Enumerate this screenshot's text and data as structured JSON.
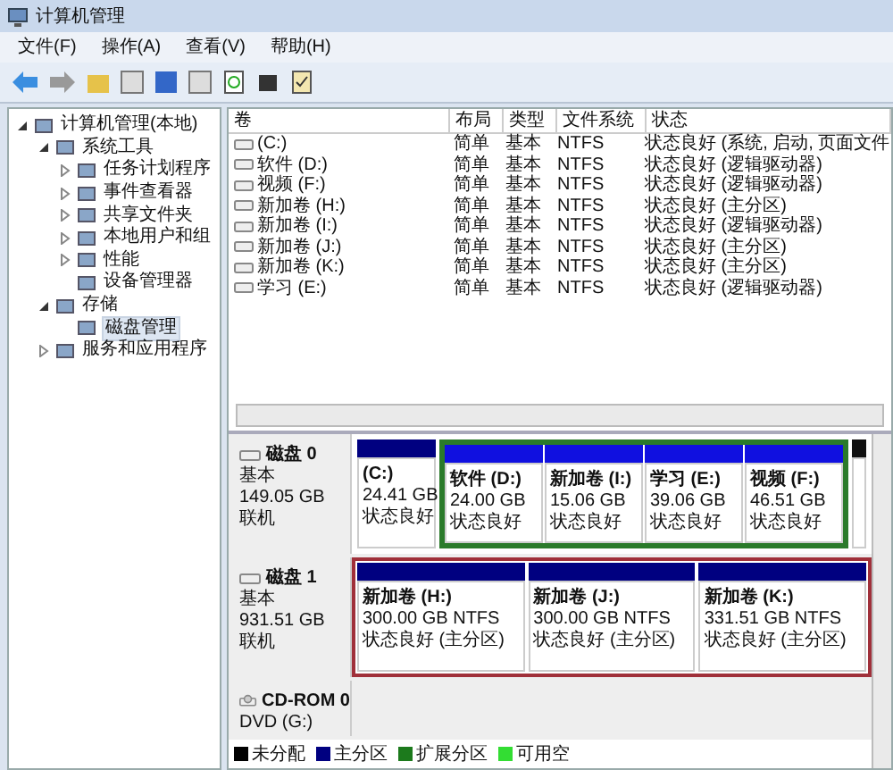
{
  "window": {
    "title": "计算机管理"
  },
  "menu": [
    "文件(F)",
    "操作(A)",
    "查看(V)",
    "帮助(H)"
  ],
  "tree": [
    {
      "label": "计算机管理(本地)",
      "expanded": true,
      "selected": false,
      "children": [
        {
          "label": "系统工具",
          "expanded": true,
          "selected": false,
          "children": [
            {
              "label": "任务计划程序",
              "expanded": false,
              "selected": false
            },
            {
              "label": "事件查看器",
              "expanded": false,
              "selected": false
            },
            {
              "label": "共享文件夹",
              "expanded": false,
              "selected": false
            },
            {
              "label": "本地用户和组",
              "expanded": false,
              "selected": false
            },
            {
              "label": "性能",
              "expanded": false,
              "selected": false
            },
            {
              "label": "设备管理器",
              "selected": false
            }
          ]
        },
        {
          "label": "存储",
          "expanded": true,
          "selected": false,
          "children": [
            {
              "label": "磁盘管理",
              "selected": true
            }
          ]
        },
        {
          "label": "服务和应用程序",
          "expanded": false,
          "selected": false
        }
      ]
    }
  ],
  "volumes": {
    "columns": [
      "卷",
      "布局",
      "类型",
      "文件系统",
      "状态"
    ],
    "rows": [
      [
        "(C:)",
        "简单",
        "基本",
        "NTFS",
        "状态良好 (系统, 启动, 页面文件"
      ],
      [
        "软件 (D:)",
        "简单",
        "基本",
        "NTFS",
        "状态良好 (逻辑驱动器)"
      ],
      [
        "视频 (F:)",
        "简单",
        "基本",
        "NTFS",
        "状态良好 (逻辑驱动器)"
      ],
      [
        "新加卷 (H:)",
        "简单",
        "基本",
        "NTFS",
        "状态良好 (主分区)"
      ],
      [
        "新加卷 (I:)",
        "简单",
        "基本",
        "NTFS",
        "状态良好 (逻辑驱动器)"
      ],
      [
        "新加卷 (J:)",
        "简单",
        "基本",
        "NTFS",
        "状态良好 (主分区)"
      ],
      [
        "新加卷 (K:)",
        "简单",
        "基本",
        "NTFS",
        "状态良好 (主分区)"
      ],
      [
        "学习 (E:)",
        "简单",
        "基本",
        "NTFS",
        "状态良好 (逻辑驱动器)"
      ]
    ]
  },
  "disks": [
    {
      "kind": "disk",
      "name": "磁盘 0",
      "type": "基本",
      "size": "149.05 GB",
      "status": "联机",
      "selected": false,
      "partitions": [
        {
          "kind": "primary",
          "name": "(C:)",
          "size": "24.41 GB",
          "status": "状态良好"
        },
        {
          "kind": "extended",
          "parts": [
            {
              "kind": "logical",
              "name": "软件 (D:)",
              "size": "24.00 GB",
              "status": "状态良好"
            },
            {
              "kind": "logical",
              "name": "新加卷 (I:)",
              "size": "15.06 GB",
              "status": "状态良好"
            },
            {
              "kind": "logical",
              "name": "学习 (E:)",
              "size": "39.06 GB",
              "status": "状态良好"
            },
            {
              "kind": "logical",
              "name": "视频 (F:)",
              "size": "46.51 GB",
              "status": "状态良好"
            }
          ]
        },
        {
          "kind": "sliver"
        }
      ]
    },
    {
      "kind": "disk",
      "name": "磁盘 1",
      "type": "基本",
      "size": "931.51 GB",
      "status": "联机",
      "selected": true,
      "partitions": [
        {
          "kind": "primary",
          "name": "新加卷 (H:)",
          "size": "300.00 GB NTFS",
          "status": "状态良好 (主分区)"
        },
        {
          "kind": "primary",
          "name": "新加卷 (J:)",
          "size": "300.00 GB NTFS",
          "status": "状态良好 (主分区)"
        },
        {
          "kind": "primary",
          "name": "新加卷 (K:)",
          "size": "331.51 GB NTFS",
          "status": "状态良好 (主分区)"
        }
      ]
    },
    {
      "kind": "cdrom",
      "name": "CD-ROM 0",
      "type": "DVD (G:)"
    }
  ],
  "legend": [
    {
      "label": "未分配",
      "color": "#000000"
    },
    {
      "label": "主分区",
      "color": "#000080"
    },
    {
      "label": "扩展分区",
      "color": "#1c7a1c"
    },
    {
      "label": "可用空",
      "color": "#33dd33"
    }
  ]
}
